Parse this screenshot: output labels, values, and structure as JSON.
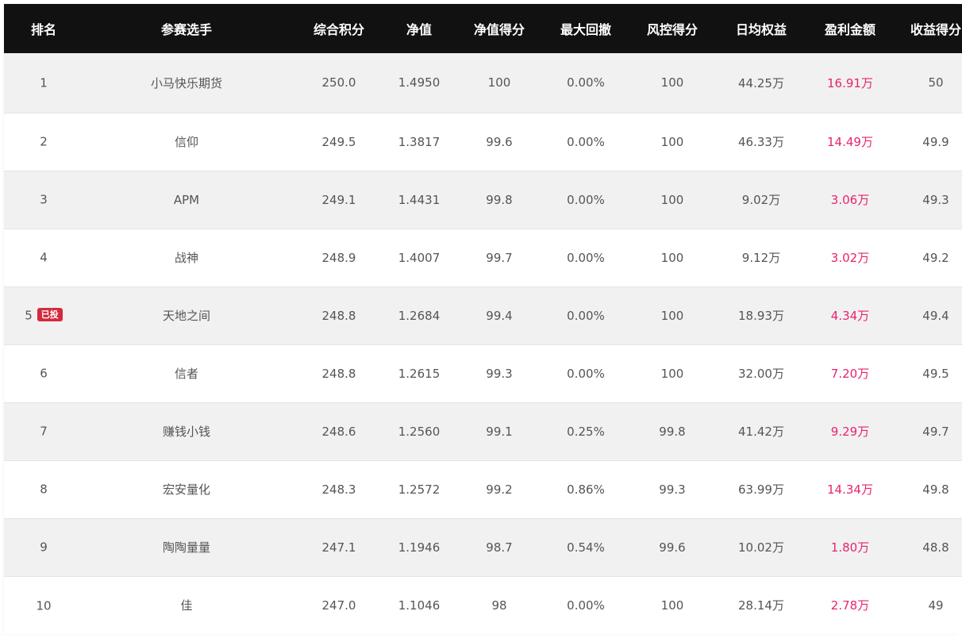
{
  "table": {
    "headers": [
      "排名",
      "参赛选手",
      "综合积分",
      "净值",
      "净值得分",
      "最大回撤",
      "风控得分",
      "日均权益",
      "盈利金额",
      "收益得分"
    ],
    "badge_label": "已投",
    "profit_color": "#e8236f",
    "rows": [
      {
        "rank": "1",
        "name": "小马快乐期货",
        "score": "250.0",
        "nav": "1.4950",
        "nav_score": "100",
        "max_drawdown": "0.00%",
        "risk_score": "100",
        "avg_equity": "44.25万",
        "profit": "16.91万",
        "return_score": "50",
        "badge": false
      },
      {
        "rank": "2",
        "name": "信仰",
        "score": "249.5",
        "nav": "1.3817",
        "nav_score": "99.6",
        "max_drawdown": "0.00%",
        "risk_score": "100",
        "avg_equity": "46.33万",
        "profit": "14.49万",
        "return_score": "49.9",
        "badge": false
      },
      {
        "rank": "3",
        "name": "APM",
        "score": "249.1",
        "nav": "1.4431",
        "nav_score": "99.8",
        "max_drawdown": "0.00%",
        "risk_score": "100",
        "avg_equity": "9.02万",
        "profit": "3.06万",
        "return_score": "49.3",
        "badge": false
      },
      {
        "rank": "4",
        "name": "战神",
        "score": "248.9",
        "nav": "1.4007",
        "nav_score": "99.7",
        "max_drawdown": "0.00%",
        "risk_score": "100",
        "avg_equity": "9.12万",
        "profit": "3.02万",
        "return_score": "49.2",
        "badge": false
      },
      {
        "rank": "5",
        "name": "天地之间",
        "score": "248.8",
        "nav": "1.2684",
        "nav_score": "99.4",
        "max_drawdown": "0.00%",
        "risk_score": "100",
        "avg_equity": "18.93万",
        "profit": "4.34万",
        "return_score": "49.4",
        "badge": true
      },
      {
        "rank": "6",
        "name": "信者",
        "score": "248.8",
        "nav": "1.2615",
        "nav_score": "99.3",
        "max_drawdown": "0.00%",
        "risk_score": "100",
        "avg_equity": "32.00万",
        "profit": "7.20万",
        "return_score": "49.5",
        "badge": false
      },
      {
        "rank": "7",
        "name": "赚钱小钱",
        "score": "248.6",
        "nav": "1.2560",
        "nav_score": "99.1",
        "max_drawdown": "0.25%",
        "risk_score": "99.8",
        "avg_equity": "41.42万",
        "profit": "9.29万",
        "return_score": "49.7",
        "badge": false
      },
      {
        "rank": "8",
        "name": "宏安量化",
        "score": "248.3",
        "nav": "1.2572",
        "nav_score": "99.2",
        "max_drawdown": "0.86%",
        "risk_score": "99.3",
        "avg_equity": "63.99万",
        "profit": "14.34万",
        "return_score": "49.8",
        "badge": false
      },
      {
        "rank": "9",
        "name": "陶陶量量",
        "score": "247.1",
        "nav": "1.1946",
        "nav_score": "98.7",
        "max_drawdown": "0.54%",
        "risk_score": "99.6",
        "avg_equity": "10.02万",
        "profit": "1.80万",
        "return_score": "48.8",
        "badge": false
      },
      {
        "rank": "10",
        "name": "佳",
        "score": "247.0",
        "nav": "1.1046",
        "nav_score": "98",
        "max_drawdown": "0.00%",
        "risk_score": "100",
        "avg_equity": "28.14万",
        "profit": "2.78万",
        "return_score": "49",
        "badge": false
      }
    ]
  }
}
